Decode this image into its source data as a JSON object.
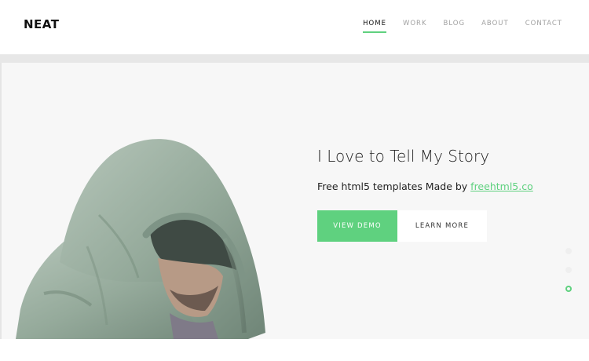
{
  "header": {
    "logo": "NEAT",
    "nav": [
      {
        "label": "HOME",
        "active": true
      },
      {
        "label": "WORK",
        "active": false
      },
      {
        "label": "BLOG",
        "active": false
      },
      {
        "label": "ABOUT",
        "active": false
      },
      {
        "label": "CONTACT",
        "active": false
      }
    ]
  },
  "hero": {
    "title": "I Love to Tell My Story",
    "subtitle_prefix": "Free html5 templates Made by ",
    "subtitle_link": "freehtml5.co",
    "primary_button": "VIEW DEMO",
    "secondary_button": "LEARN MORE",
    "slider_dots": {
      "count": 3,
      "active_index": 2
    }
  },
  "colors": {
    "accent": "#5fd17f",
    "hero_bg": "#f7f7f7",
    "hoodie": "#9db1a3"
  }
}
